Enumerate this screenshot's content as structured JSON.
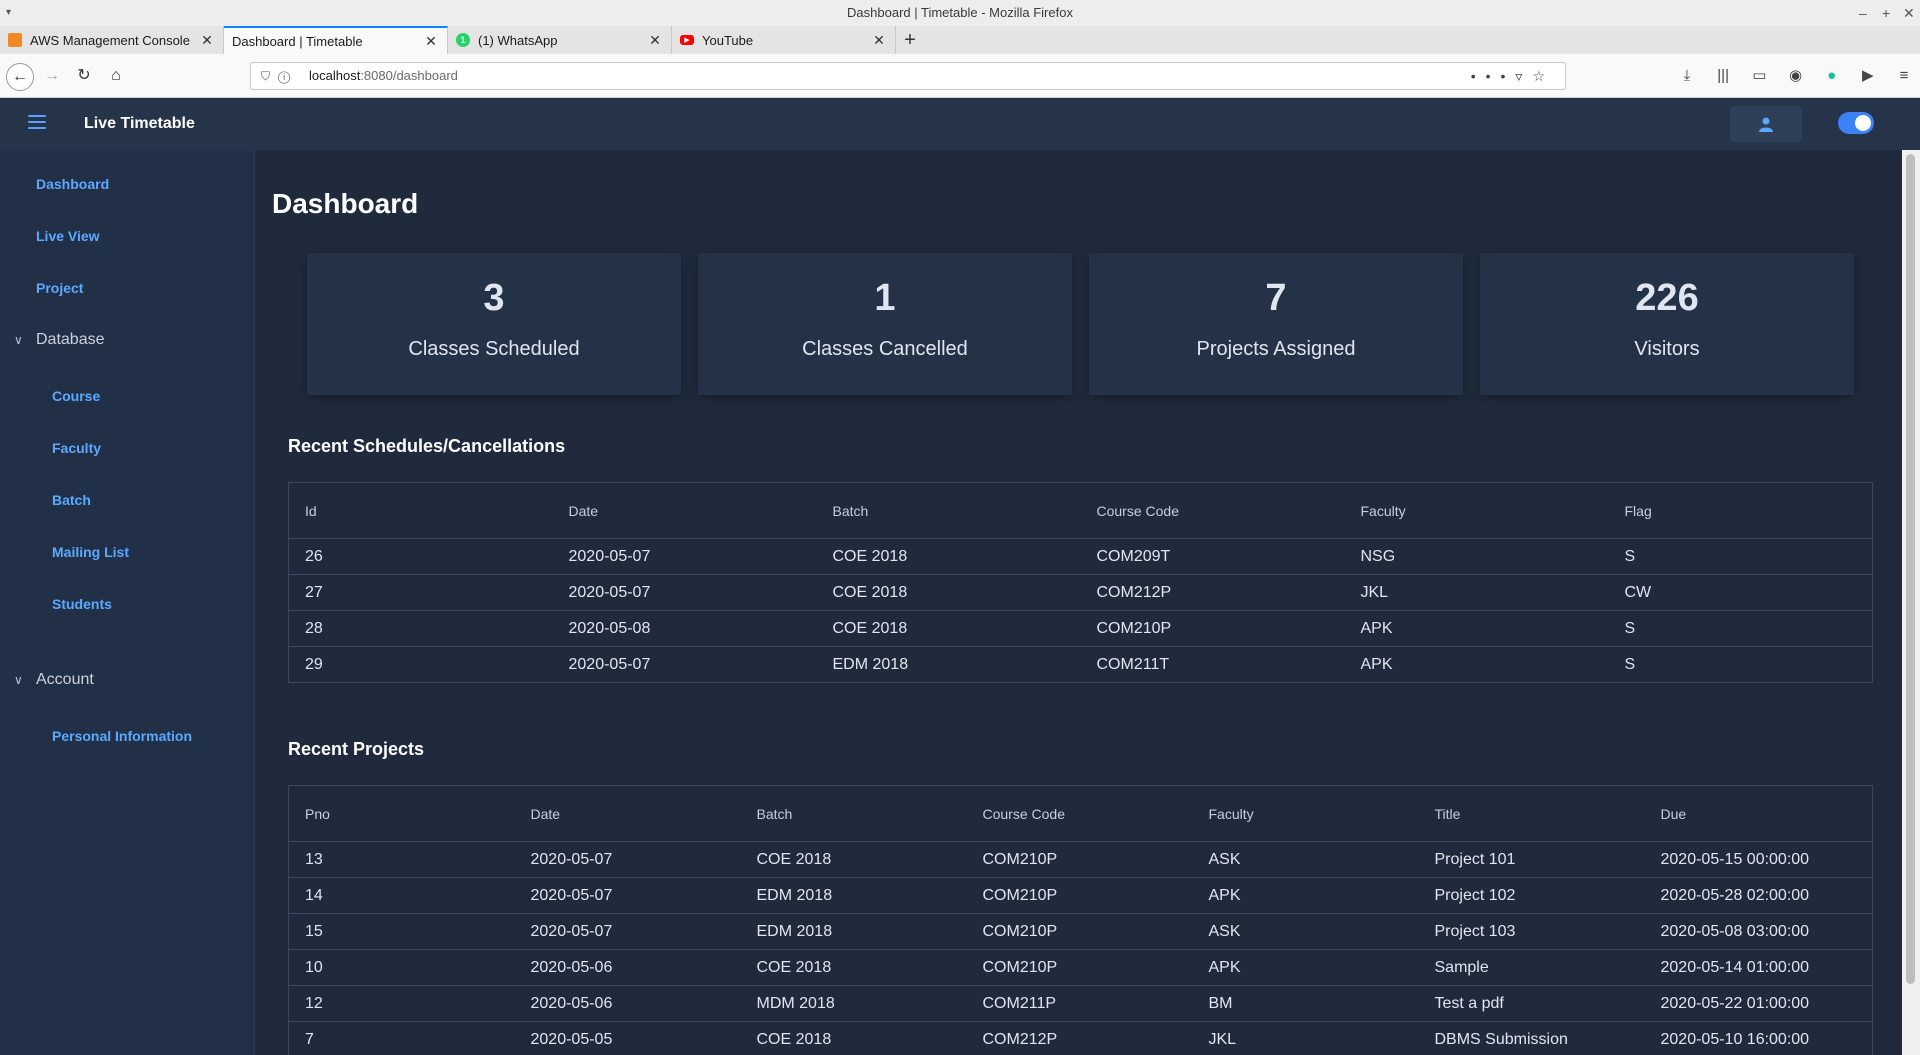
{
  "window": {
    "title": "Dashboard | Timetable - Mozilla Firefox"
  },
  "tabs": [
    {
      "label": "AWS Management Console",
      "favicon_color": "#f08a24"
    },
    {
      "label": "Dashboard | Timetable",
      "favicon_color": ""
    },
    {
      "label": "(1) WhatsApp",
      "favicon_color": "#25d366"
    },
    {
      "label": "YouTube",
      "favicon_color": "#ff0000"
    }
  ],
  "urlbar": {
    "host": "localhost",
    "path": ":8080/dashboard"
  },
  "app": {
    "name": "Live Timetable",
    "accent": "#5aa9ff"
  },
  "sidebar": {
    "items": [
      "Dashboard",
      "Live View",
      "Project"
    ],
    "database": {
      "label": "Database",
      "items": [
        "Course",
        "Faculty",
        "Batch",
        "Mailing List",
        "Students"
      ]
    },
    "account": {
      "label": "Account",
      "items": [
        "Personal Information"
      ]
    }
  },
  "page": {
    "title": "Dashboard"
  },
  "stats": [
    {
      "value": "3",
      "label": "Classes Scheduled"
    },
    {
      "value": "1",
      "label": "Classes Cancelled"
    },
    {
      "value": "7",
      "label": "Projects Assigned"
    },
    {
      "value": "226",
      "label": "Visitors"
    }
  ],
  "schedules": {
    "title": "Recent Schedules/Cancellations",
    "headers": [
      "Id",
      "Date",
      "Batch",
      "Course Code",
      "Faculty",
      "Flag"
    ],
    "rows": [
      [
        "26",
        "2020-05-07",
        "COE 2018",
        "COM209T",
        "NSG",
        "S"
      ],
      [
        "27",
        "2020-05-07",
        "COE 2018",
        "COM212P",
        "JKL",
        "CW"
      ],
      [
        "28",
        "2020-05-08",
        "COE 2018",
        "COM210P",
        "APK",
        "S"
      ],
      [
        "29",
        "2020-05-07",
        "EDM 2018",
        "COM211T",
        "APK",
        "S"
      ]
    ]
  },
  "projects": {
    "title": "Recent Projects",
    "headers": [
      "Pno",
      "Date",
      "Batch",
      "Course Code",
      "Faculty",
      "Title",
      "Due"
    ],
    "rows": [
      [
        "13",
        "2020-05-07",
        "COE 2018",
        "COM210P",
        "ASK",
        "Project 101",
        "2020-05-15 00:00:00"
      ],
      [
        "14",
        "2020-05-07",
        "EDM 2018",
        "COM210P",
        "APK",
        "Project 102",
        "2020-05-28 02:00:00"
      ],
      [
        "15",
        "2020-05-07",
        "EDM 2018",
        "COM210P",
        "ASK",
        "Project 103",
        "2020-05-08 03:00:00"
      ],
      [
        "10",
        "2020-05-06",
        "COE 2018",
        "COM210P",
        "APK",
        "Sample",
        "2020-05-14 01:00:00"
      ],
      [
        "12",
        "2020-05-06",
        "MDM 2018",
        "COM211P",
        "BM",
        "Test a pdf",
        "2020-05-22 01:00:00"
      ],
      [
        "7",
        "2020-05-05",
        "COE 2018",
        "COM212P",
        "JKL",
        "DBMS Submission",
        "2020-05-10 16:00:00"
      ]
    ]
  }
}
